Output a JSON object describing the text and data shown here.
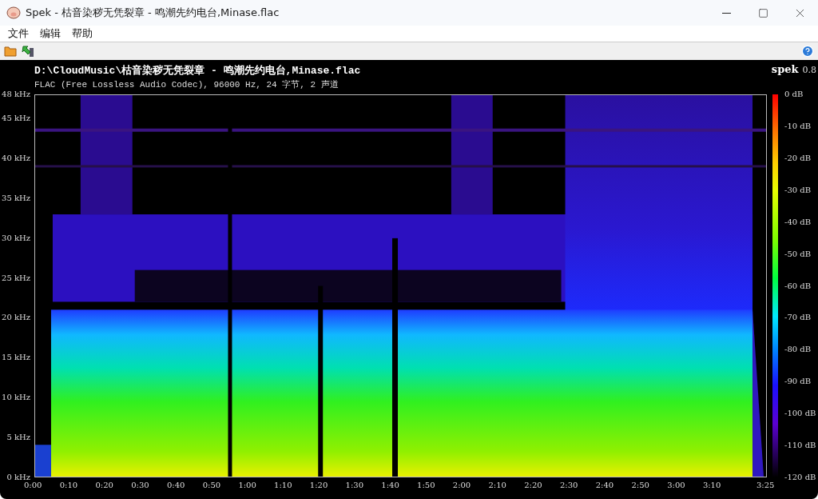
{
  "window": {
    "title": "Spek - 枯音染秽无凭裂章 - 鸣潮先约电台,Minase.flac"
  },
  "menu": [
    "文件",
    "编辑",
    "帮助"
  ],
  "viewer": {
    "file_path": "D:\\CloudMusic\\枯音染秽无凭裂章 - 鸣潮先约电台,Minase.flac",
    "file_info": "FLAC (Free Lossless Audio Codec), 96000 Hz, 24 字节, 2 声道",
    "brand": "spek",
    "version": "0.8",
    "frequency_ticks": [
      "48 kHz",
      "45 kHz",
      "40 kHz",
      "35 kHz",
      "30 kHz",
      "25 kHz",
      "20 kHz",
      "15 kHz",
      "10 kHz",
      "5 kHz",
      "0 kHz"
    ],
    "time_ticks": [
      "0:00",
      "0:10",
      "0:20",
      "0:30",
      "0:40",
      "0:50",
      "1:00",
      "1:10",
      "1:20",
      "1:30",
      "1:40",
      "1:50",
      "2:00",
      "2:10",
      "2:20",
      "2:30",
      "2:40",
      "2:50",
      "3:00",
      "3:10",
      "3:25"
    ],
    "level_ticks": [
      "0 dB",
      "-10 dB",
      "-20 dB",
      "-30 dB",
      "-40 dB",
      "-50 dB",
      "-60 dB",
      "-70 dB",
      "-80 dB",
      "-90 dB",
      "-100 dB",
      "-110 dB",
      "-120 dB"
    ]
  }
}
